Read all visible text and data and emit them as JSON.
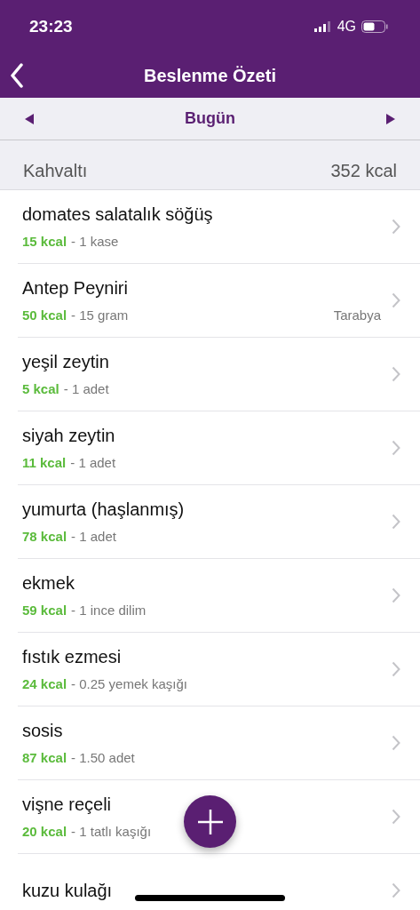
{
  "status_bar": {
    "time": "23:23",
    "network": "4G"
  },
  "nav": {
    "title": "Beslenme Özeti"
  },
  "date_bar": {
    "label": "Bugün"
  },
  "section": {
    "title": "Kahvaltı",
    "total": "352 kcal"
  },
  "items": [
    {
      "name": "domates salatalık söğüş",
      "kcal": "15 kcal",
      "detail": "- 1 kase"
    },
    {
      "name": "Antep Peyniri",
      "kcal": "50 kcal",
      "detail": "- 15 gram",
      "brand": "Tarabya"
    },
    {
      "name": "yeşil zeytin",
      "kcal": "5 kcal",
      "detail": "- 1 adet"
    },
    {
      "name": "siyah zeytin",
      "kcal": "11 kcal",
      "detail": "- 1 adet"
    },
    {
      "name": "yumurta (haşlanmış)",
      "kcal": "78 kcal",
      "detail": "- 1 adet"
    },
    {
      "name": "ekmek",
      "kcal": "59 kcal",
      "detail": "- 1 ince dilim"
    },
    {
      "name": "fıstık ezmesi",
      "kcal": "24 kcal",
      "detail": "- 0.25 yemek kaşığı"
    },
    {
      "name": "sosis",
      "kcal": "87 kcal",
      "detail": "- 1.50 adet"
    },
    {
      "name": "vişne reçeli",
      "kcal": "20 kcal",
      "detail": "- 1 tatlı kaşığı"
    },
    {
      "name": "kuzu kulağı"
    }
  ]
}
